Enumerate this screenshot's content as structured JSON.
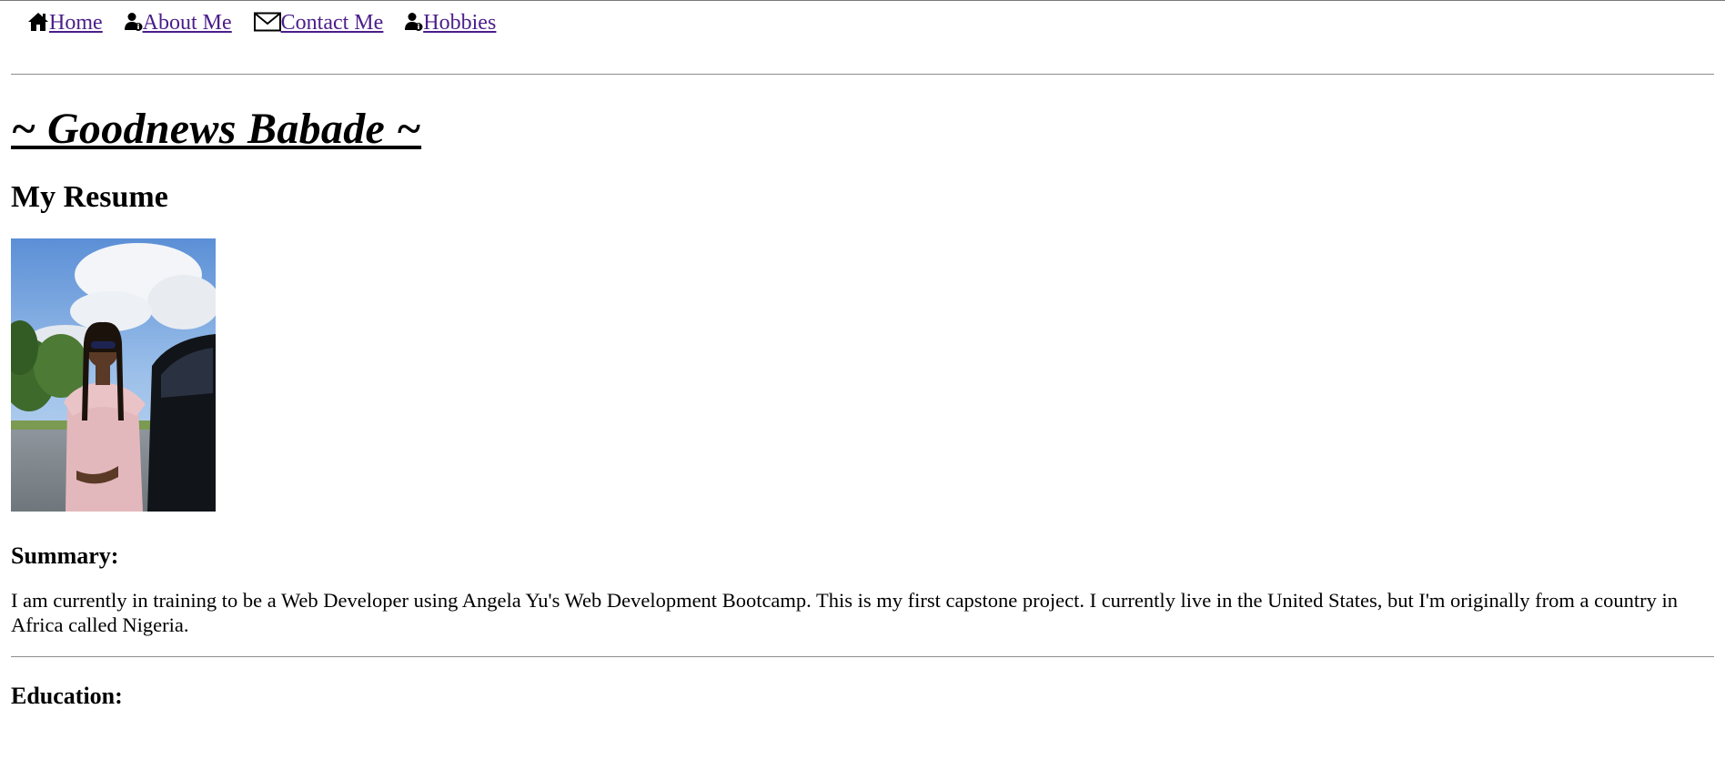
{
  "nav": {
    "items": [
      {
        "label": "Home",
        "icon": "home-icon"
      },
      {
        "label": "About Me",
        "icon": "user-info-icon"
      },
      {
        "label": "Contact Me",
        "icon": "envelope-icon"
      },
      {
        "label": "Hobbies",
        "icon": "user-info-icon"
      }
    ],
    "link_color": "#4b1e8a"
  },
  "header": {
    "title": "~ Goodnews Babade ~",
    "subtitle": "My Resume"
  },
  "summary": {
    "heading": "Summary:",
    "text": "I am currently in training to be a Web Developer using Angela Yu's Web Development Bootcamp. This is my first capstone project. I currently live in the United States, but I'm originally from a country in Africa called Nigeria."
  },
  "education": {
    "heading": "Education:"
  }
}
